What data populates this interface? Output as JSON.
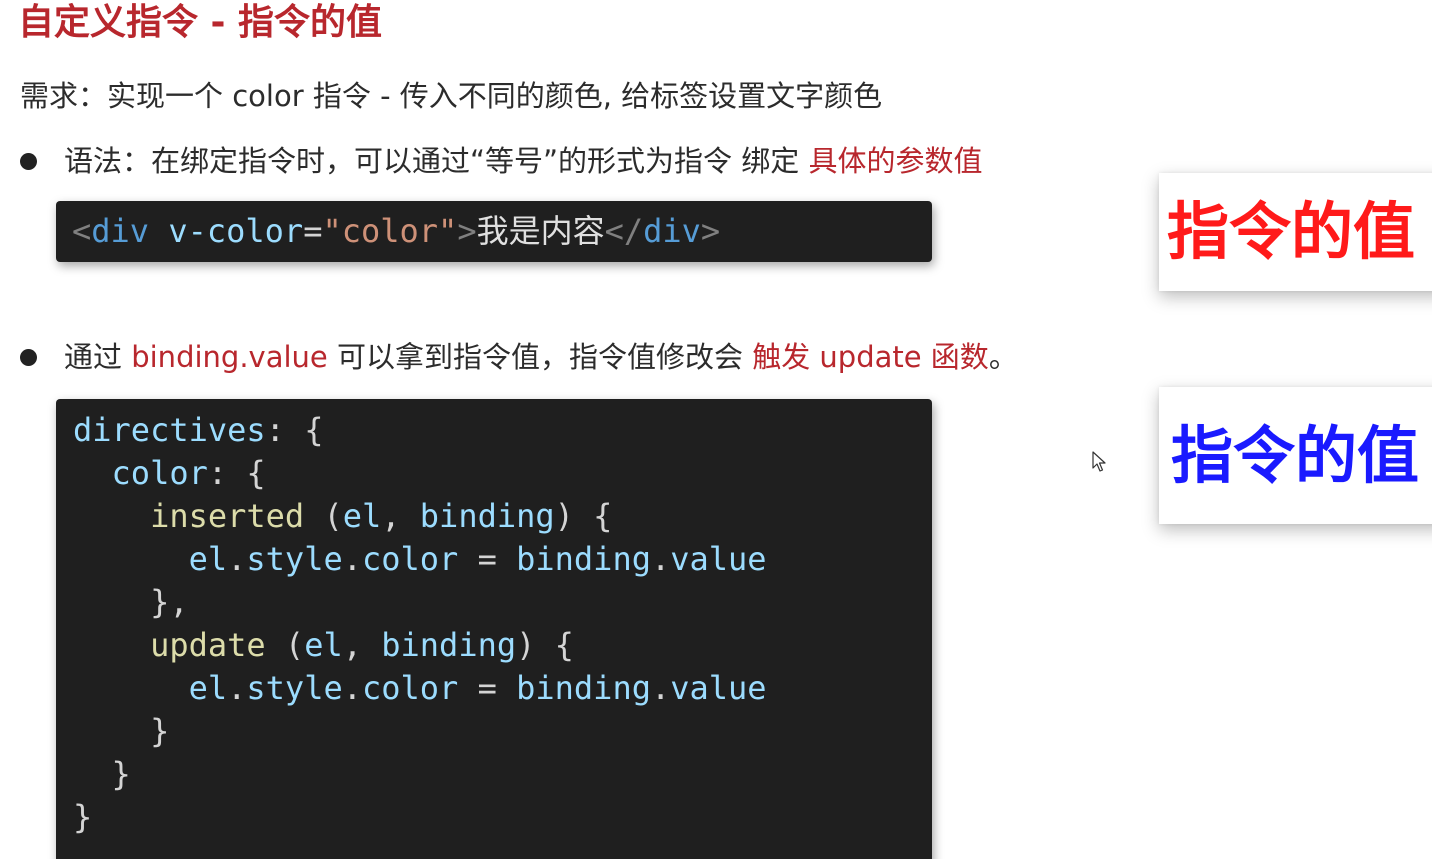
{
  "title": "自定义指令 - 指令的值",
  "requirement": "需求：实现一个 color 指令 - 传入不同的颜色, 给标签设置文字颜色",
  "bullet1": {
    "text": "语法：在绑定指令时，可以通过“等号”的形式为指令 绑定 ",
    "highlight": "具体的参数值"
  },
  "code_inline": {
    "open_lt": "<",
    "tag": "div",
    "attr": "v-color",
    "eq": "=",
    "value": "\"color\"",
    "open_gt": ">",
    "content": "我是内容",
    "close_lt": "</",
    "close_tag": "div",
    "close_gt": ">"
  },
  "bullet2": {
    "pre": "通过 ",
    "highlight1": "binding.value",
    "mid": " 可以拿到指令值，指令值修改会 ",
    "highlight2": "触发 update 函数",
    "post": "。"
  },
  "code_block": {
    "l1_key": "directives",
    "l1_rest": ": {",
    "l2_indent": "  ",
    "l2_key": "color",
    "l2_rest": ": {",
    "l3_indent": "    ",
    "l3_fn": "inserted",
    "l3_p1": " (",
    "l3_a1": "el",
    "l3_comma": ", ",
    "l3_a2": "binding",
    "l3_p2": ") {",
    "l4_indent": "      ",
    "l4_a": "el",
    "l4_d1": ".",
    "l4_b": "style",
    "l4_d2": ".",
    "l4_c": "color",
    "l4_eq": " = ",
    "l4_d": "binding",
    "l4_d3": ".",
    "l4_e": "value",
    "l5": "    },",
    "l6_indent": "    ",
    "l6_fn": "update",
    "l6_p1": " (",
    "l6_a1": "el",
    "l6_comma": ", ",
    "l6_a2": "binding",
    "l6_p2": ") {",
    "l7_indent": "      ",
    "l7_a": "el",
    "l7_d1": ".",
    "l7_b": "style",
    "l7_d2": ".",
    "l7_c": "color",
    "l7_eq": " = ",
    "l7_d": "binding",
    "l7_d3": ".",
    "l7_e": "value",
    "l8": "    }",
    "l9": "  }",
    "l10": "}"
  },
  "demo_red": {
    "text": "指令的值",
    "color": "#ff1a1a"
  },
  "demo_blue": {
    "text": "指令的值",
    "color": "#1a1aff"
  },
  "colors": {
    "accent": "#b8272d",
    "code_bg": "#1f1f1f"
  },
  "cursor_icon": "mouse-pointer-icon"
}
